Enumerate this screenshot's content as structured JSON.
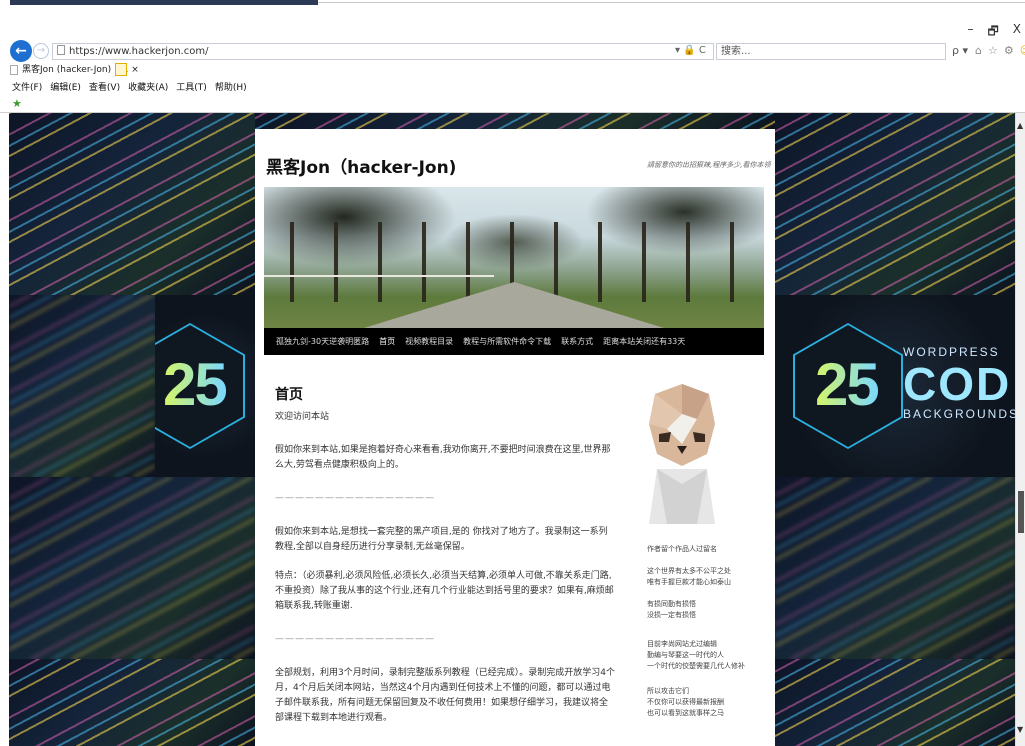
{
  "browser": {
    "window_controls": [
      "–",
      "🗗",
      "X"
    ],
    "back_icon": "back-arrow-icon",
    "forward_icon": "forward-arrow-icon",
    "address": "https://www.hackerjon.com/",
    "address_tools": "▾ 🔒 C",
    "search_placeholder": "搜索...",
    "search_go": "ρ ▾",
    "tab_title": "黑客Jon (hacker-Jon) | ... ×",
    "menu": [
      "文件(F)",
      "编辑(E)",
      "查看(V)",
      "收藏夹(A)",
      "工具(T)",
      "帮助(H)"
    ]
  },
  "background": {
    "left_number": "25",
    "right_number": "25",
    "brand_top": "WORDPRESS",
    "brand_big": "COD",
    "brand_bottom": "BACKGROUNDS"
  },
  "site": {
    "title": "黑客Jon（hacker-Jon)",
    "description": "請留意你的出招狠辣,程序多少,看你本领",
    "nav": [
      "孤独九剑-30天逆袭明匿路",
      "首页",
      "视频教程目录",
      "教程与所需软件命令下载",
      "联系方式",
      "距离本站关闭还有33天"
    ],
    "page_heading": "首页",
    "welcome": "欢迎访问本站",
    "para1": "假如你来到本站,如果是抱着好奇心来看看,我劝你离开,不要把时间浪费在这里,世界那么大,劳驾看点健康积极向上的。",
    "divider1": "————————————————",
    "para2": "假如你来到本站,是想找一套完整的黑产项目,是的 你找对了地方了。我录制这一系列教程,全部以自身经历进行分享录制,无丝毫保留。",
    "para3": "特点：（必须暴利,必须风险低,必须长久,必须当天结算,必须单人可做,不靠关系走门路,不重投资）除了我从事的这个行业,还有几个行业能达到括号里的要求？如果有,麻烦邮箱联系我,转账重谢.",
    "divider2": "————————————————",
    "para4": "全部规划，利用3个月时间，录制完整版系列教程（已经完成）。录制完成开放学习4个月，4个月后关闭本网站，当然这4个月内遇到任何技术上不懂的问题，都可以通过电子邮件联系我，所有问题无保留回复及不收任何费用！如果想仔细学习，我建议将全部课程下载到本地进行观看。"
  },
  "sidebar": {
    "caption": "作者留个作品人过留名",
    "lines1": [
      "这个世界有太多不公平之处",
      "唯有手握巨款才能心如泰山"
    ],
    "lines2": [
      "有损同勤有损悟",
      "没损一定有损悟"
    ],
    "lines3": [
      "目前李尚网站尤过编辑",
      "勤编与琴要这一时代的人",
      "一个时代的佼楚需要几代人修补"
    ],
    "lines4": [
      "所以攻击它们",
      "不仅你可以获得最新报酬",
      "也可以看到这就事样之马"
    ]
  }
}
